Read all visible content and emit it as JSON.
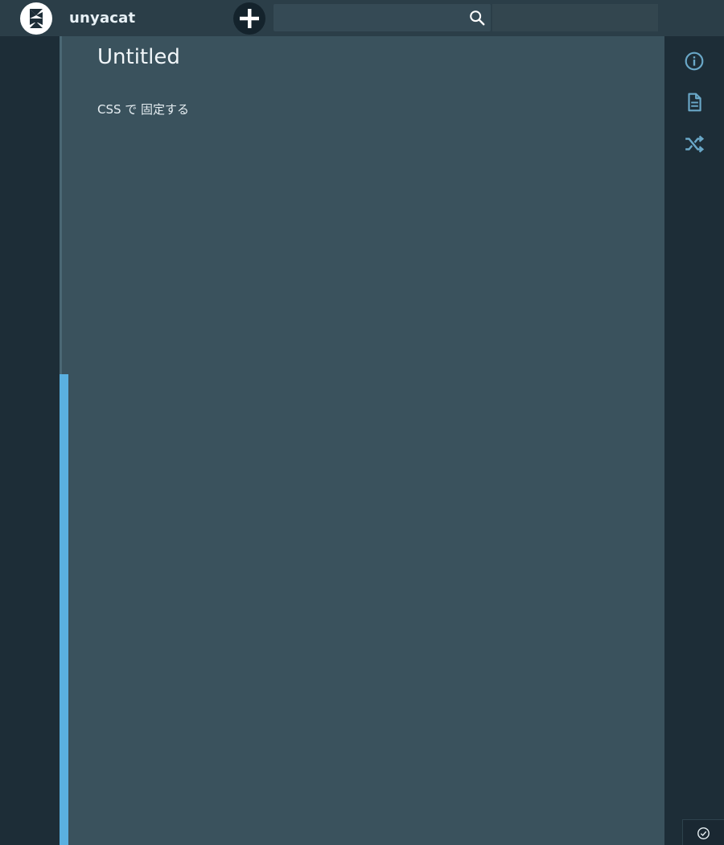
{
  "header": {
    "username": "unyacat",
    "search": {
      "value": "",
      "placeholder": ""
    }
  },
  "icons": {
    "logo": "app-logo-icon",
    "add": "plus-icon",
    "search": "search-icon",
    "info": "info-icon",
    "document": "document-icon",
    "shuffle": "shuffle-icon",
    "status": "check-circle-icon"
  },
  "document": {
    "title": "Untitled",
    "body": "CSS で 固定する"
  },
  "colors": {
    "background": "#1d2d37",
    "topbar": "#2b3e48",
    "editor": "#3a525d",
    "accent": "#5ab0e0",
    "rail_icon": "#6aa8c8"
  }
}
